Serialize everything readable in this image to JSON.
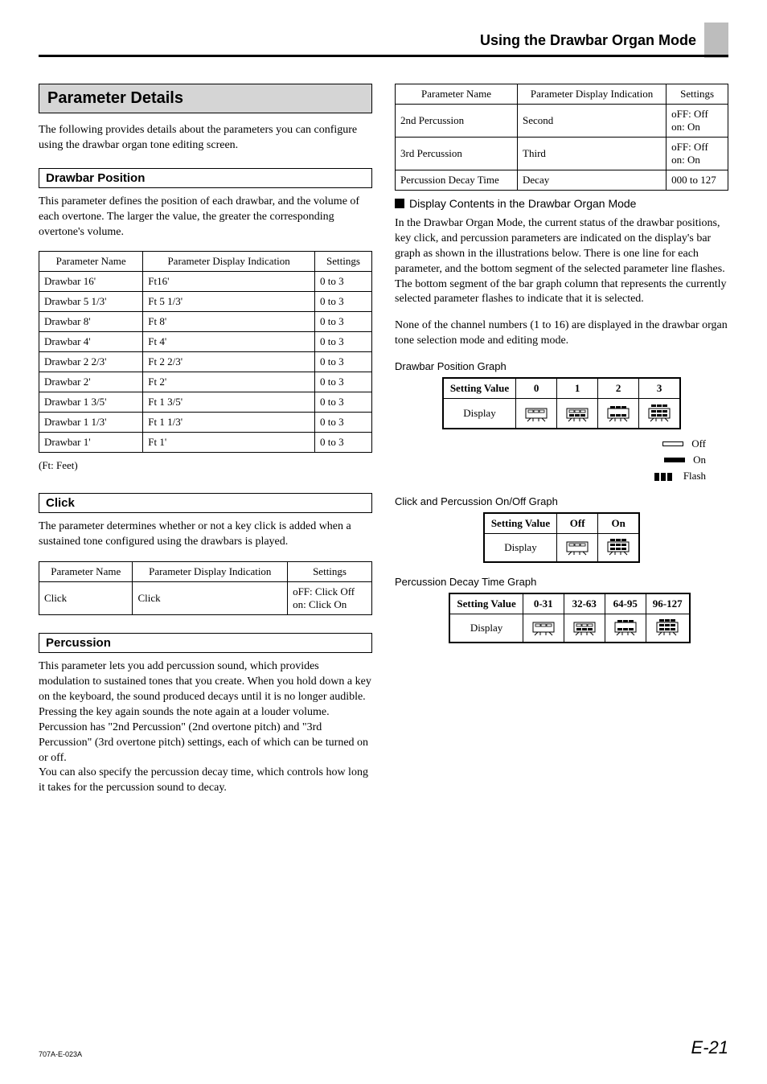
{
  "header": {
    "title": "Using the Drawbar Organ Mode"
  },
  "left": {
    "param_details_title": "Parameter Details",
    "intro": "The following provides details about the parameters you can configure using the drawbar organ tone editing screen.",
    "drawbar_heading": "Drawbar Position",
    "drawbar_intro": "This parameter defines the position of each drawbar, and the volume of each overtone. The larger the value, the greater the corresponding overtone's volume.",
    "drawbar_table": {
      "headers": [
        "Parameter Name",
        "Parameter Display Indication",
        "Settings"
      ],
      "rows": [
        [
          "Drawbar 16'",
          "Ft16'",
          "0 to 3"
        ],
        [
          "Drawbar 5 1/3'",
          "Ft 5 1/3'",
          "0 to 3"
        ],
        [
          "Drawbar 8'",
          "Ft 8'",
          "0 to 3"
        ],
        [
          "Drawbar 4'",
          "Ft 4'",
          "0 to 3"
        ],
        [
          "Drawbar 2 2/3'",
          "Ft 2 2/3'",
          "0 to 3"
        ],
        [
          "Drawbar 2'",
          "Ft 2'",
          "0 to 3"
        ],
        [
          "Drawbar 1 3/5'",
          "Ft 1 3/5'",
          "0 to 3"
        ],
        [
          "Drawbar 1 1/3'",
          "Ft 1 1/3'",
          "0 to 3"
        ],
        [
          "Drawbar 1'",
          "Ft 1'",
          "0 to 3"
        ]
      ]
    },
    "ft_note": "(Ft: Feet)",
    "click_heading": "Click",
    "click_intro": "The parameter determines whether or not a key click is added when a sustained tone configured using the drawbars is played.",
    "click_table": {
      "headers": [
        "Parameter Name",
        "Parameter Display Indication",
        "Settings"
      ],
      "rows": [
        [
          "Click",
          "Click",
          "oFF:  Click Off\non:    Click On"
        ]
      ]
    },
    "perc_heading": "Percussion",
    "perc_intro": "This parameter lets you add percussion sound, which provides modulation to sustained tones that you create. When you hold down a key on the keyboard, the sound produced decays until it is no longer audible. Pressing the key again sounds the note again at a louder volume. Percussion has \"2nd Percussion\" (2nd overtone pitch) and \"3rd Percussion\" (3rd overtone pitch) settings, each of which can be turned on or off.\nYou can also specify the percussion decay time, which controls how long it takes for the percussion sound to decay."
  },
  "right": {
    "perc_table": {
      "headers": [
        "Parameter Name",
        "Parameter Display Indication",
        "Settings"
      ],
      "rows": [
        [
          "2nd Percussion",
          "Second",
          "oFF:  Off\non:    On"
        ],
        [
          "3rd Percussion",
          "Third",
          "oFF:  Off\non:    On"
        ],
        [
          "Percussion Decay Time",
          "Decay",
          "000 to 127"
        ]
      ]
    },
    "display_heading": "Display Contents in the Drawbar Organ Mode",
    "display_p1": "In the Drawbar Organ Mode, the current status of the drawbar positions, key click, and percussion parameters are indicated on the display's bar graph as shown in the illustrations below.  There is one line for each parameter, and the bottom segment of the selected parameter line flashes. The bottom segment of the bar graph column that represents the currently selected parameter flashes to indicate that it is selected.",
    "display_p2": "None of the channel numbers (1 to 16) are displayed in the drawbar organ tone selection mode and editing mode.",
    "pos_graph_label": "Drawbar Position Graph",
    "pos_graph": {
      "headers": [
        "Setting Value",
        "0",
        "1",
        "2",
        "3"
      ]
    },
    "display_row_label": "Display",
    "legend": {
      "off": "Off",
      "on": "On",
      "flash": "Flash"
    },
    "click_graph_label": "Click and Percussion On/Off Graph",
    "click_graph": {
      "headers": [
        "Setting Value",
        "Off",
        "On"
      ]
    },
    "decay_graph_label": "Percussion Decay Time Graph",
    "decay_graph": {
      "headers": [
        "Setting Value",
        "0-31",
        "32-63",
        "64-95",
        "96-127"
      ]
    }
  },
  "footer": {
    "left": "707A-E-023A",
    "right": "E-21"
  },
  "chart_data": [
    {
      "type": "table",
      "title": "Drawbar Position Graph",
      "columns": [
        "Setting Value",
        "0",
        "1",
        "2",
        "3"
      ],
      "rows": [
        [
          "Display",
          "glyph-0",
          "glyph-1",
          "glyph-2",
          "glyph-3"
        ]
      ],
      "legend": [
        "Off",
        "On",
        "Flash"
      ]
    },
    {
      "type": "table",
      "title": "Click and Percussion On/Off Graph",
      "columns": [
        "Setting Value",
        "Off",
        "On"
      ],
      "rows": [
        [
          "Display",
          "glyph-0",
          "glyph-3"
        ]
      ]
    },
    {
      "type": "table",
      "title": "Percussion Decay Time Graph",
      "columns": [
        "Setting Value",
        "0-31",
        "32-63",
        "64-95",
        "96-127"
      ],
      "rows": [
        [
          "Display",
          "glyph-0",
          "glyph-1",
          "glyph-2",
          "glyph-3"
        ]
      ]
    }
  ]
}
